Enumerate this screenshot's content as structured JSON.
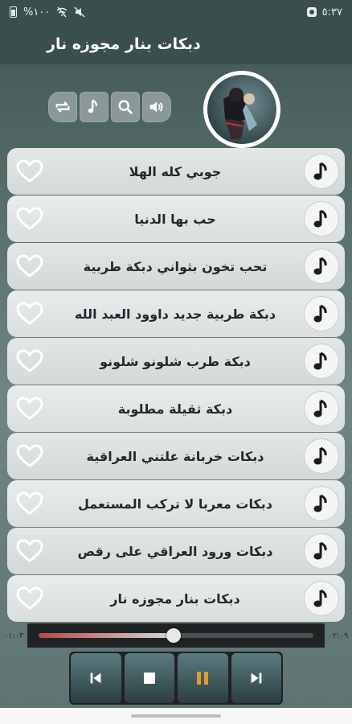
{
  "status_bar": {
    "battery_text": "%١٠٠",
    "clock": "٥:٣٧",
    "colors": {
      "background": "#3a4f4d"
    }
  },
  "app": {
    "title": "دبكات بنار مجوزه نار"
  },
  "toolbar": {
    "icons": [
      "repeat-icon",
      "music-note-icon",
      "search-icon",
      "volume-icon"
    ]
  },
  "songs": [
    {
      "title": "جوبي كله الهلا"
    },
    {
      "title": "حب بها الدنيا"
    },
    {
      "title": "تحب تخون بثواني دبكة طربية"
    },
    {
      "title": "دبكة طربية جديد داوود العبد الله"
    },
    {
      "title": "دبكة طرب شلونو شلونو"
    },
    {
      "title": "دبكة ثقيلة مطلوبة"
    },
    {
      "title": "دبكات خربانة علتني العراقية"
    },
    {
      "title": "دبكات معربا لا تركب المستعمل"
    },
    {
      "title": "دبكات ورود العراقي على رقص"
    },
    {
      "title": "دبكات بنار مجوزه نار"
    }
  ],
  "player": {
    "elapsed": "٠١:٠٣",
    "duration": "٠٢:٠٩",
    "progress": 0.49,
    "controls": [
      "previous-icon",
      "stop-icon",
      "pause-icon",
      "next-icon"
    ],
    "accent": "#e39a2e"
  }
}
